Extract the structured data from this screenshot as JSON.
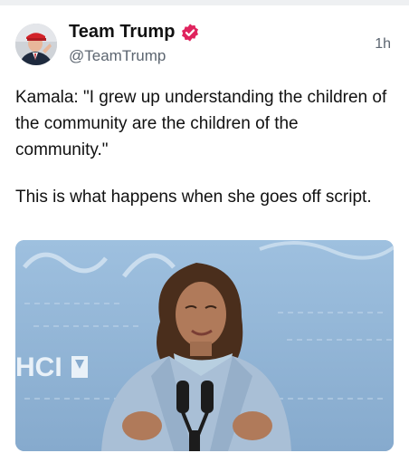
{
  "post": {
    "author": {
      "display_name": "Team Trump",
      "handle": "@TeamTrump",
      "verified_icon": "verified-badge-icon",
      "verified_color": "#e0245e"
    },
    "timestamp": "1h",
    "text": {
      "paragraph1": "Kamala: \"I grew up understanding the children of the community are the children of the community.\"",
      "paragraph2": "This is what happens when she goes off script."
    },
    "media": {
      "backdrop_text": "HCI"
    }
  }
}
